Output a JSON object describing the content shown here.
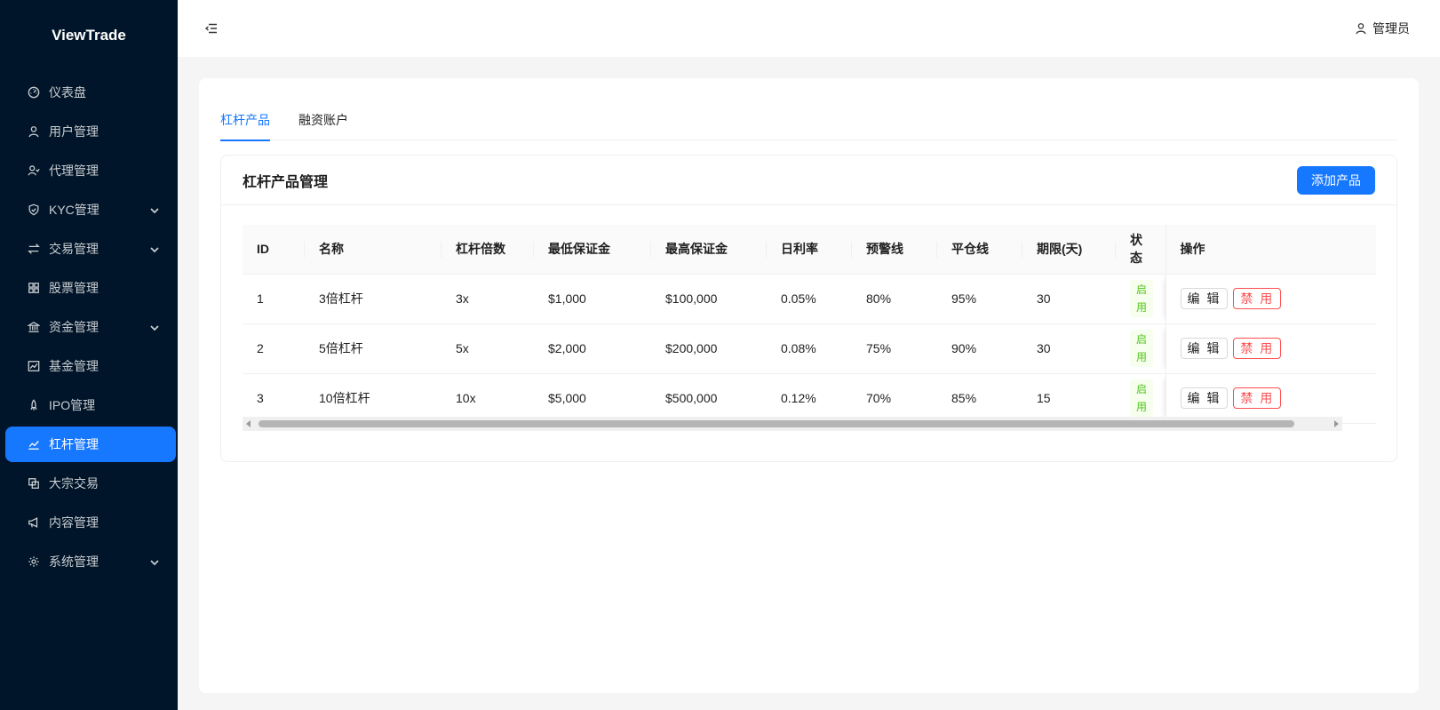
{
  "app": {
    "brand": "ViewTrade"
  },
  "sidebar": {
    "items": [
      {
        "label": "仪表盘",
        "icon": "dashboard-icon"
      },
      {
        "label": "用户管理",
        "icon": "user-icon"
      },
      {
        "label": "代理管理",
        "icon": "agent-icon"
      },
      {
        "label": "KYC管理",
        "icon": "shield-icon",
        "expandable": true
      },
      {
        "label": "交易管理",
        "icon": "swap-icon",
        "expandable": true
      },
      {
        "label": "股票管理",
        "icon": "grid-icon"
      },
      {
        "label": "资金管理",
        "icon": "bank-icon",
        "expandable": true
      },
      {
        "label": "基金管理",
        "icon": "fund-chart-icon"
      },
      {
        "label": "IPO管理",
        "icon": "rocket-icon"
      },
      {
        "label": "杠杆管理",
        "icon": "line-chart-icon",
        "active": true
      },
      {
        "label": "大宗交易",
        "icon": "block-icon"
      },
      {
        "label": "内容管理",
        "icon": "megaphone-icon"
      },
      {
        "label": "系统管理",
        "icon": "gear-icon",
        "expandable": true
      }
    ]
  },
  "header": {
    "user_label": "管理员"
  },
  "tabs": [
    {
      "label": "杠杆产品",
      "active": true
    },
    {
      "label": "融资账户",
      "active": false
    }
  ],
  "panel": {
    "title": "杠杆产品管理",
    "add_button": "添加产品"
  },
  "table": {
    "columns": [
      "ID",
      "名称",
      "杠杆倍数",
      "最低保证金",
      "最高保证金",
      "日利率",
      "预警线",
      "平仓线",
      "期限(天)",
      "状态",
      "操作"
    ],
    "rows": [
      {
        "id": "1",
        "name": "3倍杠杆",
        "leverage": "3x",
        "min_margin": "$1,000",
        "max_margin": "$100,000",
        "daily_rate": "0.05%",
        "warning_line": "80%",
        "liquidation_line": "95%",
        "term": "30",
        "status": "启用",
        "edit": "编 辑",
        "disable": "禁 用"
      },
      {
        "id": "2",
        "name": "5倍杠杆",
        "leverage": "5x",
        "min_margin": "$2,000",
        "max_margin": "$200,000",
        "daily_rate": "0.08%",
        "warning_line": "75%",
        "liquidation_line": "90%",
        "term": "30",
        "status": "启用",
        "edit": "编 辑",
        "disable": "禁 用"
      },
      {
        "id": "3",
        "name": "10倍杠杆",
        "leverage": "10x",
        "min_margin": "$5,000",
        "max_margin": "$500,000",
        "daily_rate": "0.12%",
        "warning_line": "70%",
        "liquidation_line": "85%",
        "term": "15",
        "status": "启用",
        "edit": "编 辑",
        "disable": "禁 用"
      }
    ]
  },
  "colors": {
    "sidebar_bg": "#001529",
    "accent": "#1677ff",
    "success": "#52c41a",
    "danger": "#ff4d4f"
  }
}
